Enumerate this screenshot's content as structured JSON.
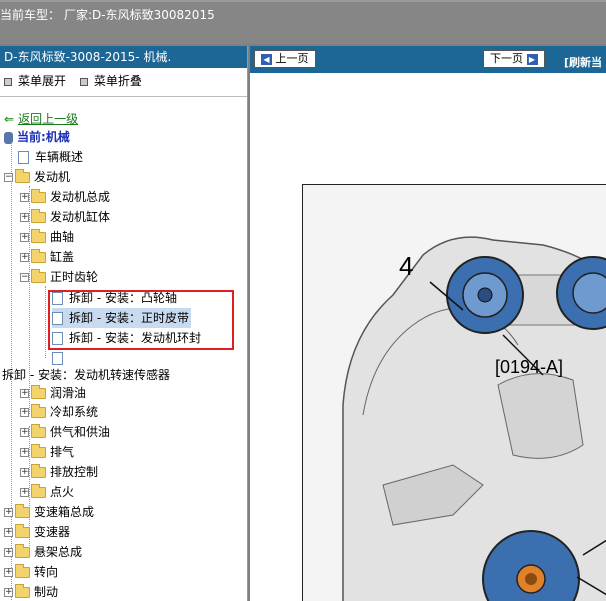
{
  "window": {
    "title_prefix": "当前车型：",
    "title_maker": "厂家:D-东风标致30082015"
  },
  "sidebar": {
    "header": "D-东风标致-3008-2015- 机械.",
    "expand_all": "菜单展开",
    "collapse_all": "菜单折叠",
    "back": "返回上一级",
    "current": "当前:机械",
    "items": [
      {
        "label": "车辆概述"
      },
      {
        "label": "发动机"
      },
      {
        "label": "发动机总成"
      },
      {
        "label": "发动机缸体"
      },
      {
        "label": "曲轴"
      },
      {
        "label": "缸盖"
      },
      {
        "label": "正时齿轮"
      },
      {
        "label": "拆卸 - 安装：凸轮轴"
      },
      {
        "label": "拆卸 - 安装：正时皮带"
      },
      {
        "label": "拆卸 - 安装：发动机环封"
      },
      {
        "label": "拆卸 - 安装：发动机转速传感器"
      },
      {
        "label": "润滑油"
      },
      {
        "label": "冷却系统"
      },
      {
        "label": "供气和供油"
      },
      {
        "label": "排气"
      },
      {
        "label": "排放控制"
      },
      {
        "label": "点火"
      },
      {
        "label": "变速箱总成"
      },
      {
        "label": "变速器"
      },
      {
        "label": "悬架总成"
      },
      {
        "label": "转向"
      },
      {
        "label": "制动"
      }
    ]
  },
  "content": {
    "prev_button": "上一页",
    "next_button": "下一页",
    "refresh": "[刷新当",
    "diagram": {
      "number": "4",
      "code": "[0194-A]"
    }
  }
}
